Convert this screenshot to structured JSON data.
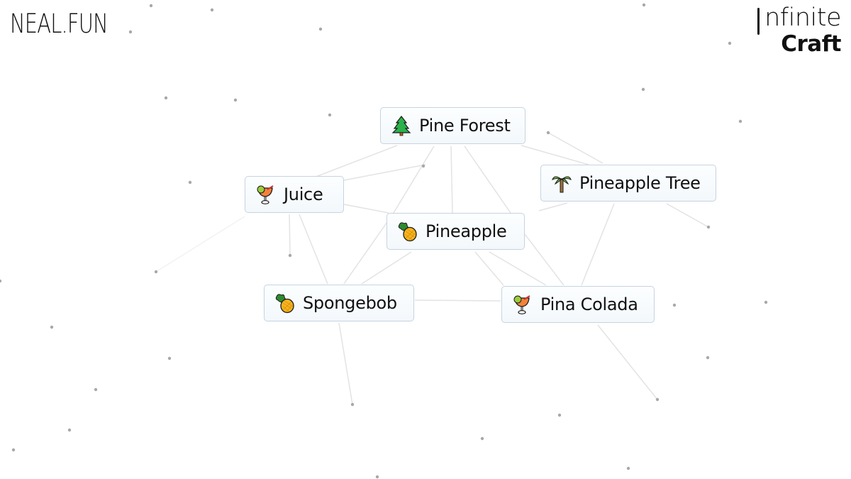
{
  "header": {
    "brand": "NEAL.FUN",
    "app_title_line1": "nfinite",
    "app_title_line2": "Craft"
  },
  "items": [
    {
      "id": "pine-forest",
      "label": "Pine Forest",
      "icon": "evergreen-tree-icon"
    },
    {
      "id": "juice",
      "label": "Juice",
      "icon": "tropical-drink-icon"
    },
    {
      "id": "pineapple-tree",
      "label": "Pineapple Tree",
      "icon": "palm-tree-icon"
    },
    {
      "id": "pineapple",
      "label": "Pineapple",
      "icon": "pineapple-icon"
    },
    {
      "id": "spongebob",
      "label": "Spongebob",
      "icon": "pineapple-icon"
    },
    {
      "id": "pina-colada",
      "label": "Pina Colada",
      "icon": "tropical-drink-icon"
    }
  ],
  "colors": {
    "background": "#ffffff",
    "item_border": "#c6d3df",
    "item_bg": "#f6fafd",
    "line": "#e6e6e6",
    "particle": "#a8a8a8"
  }
}
